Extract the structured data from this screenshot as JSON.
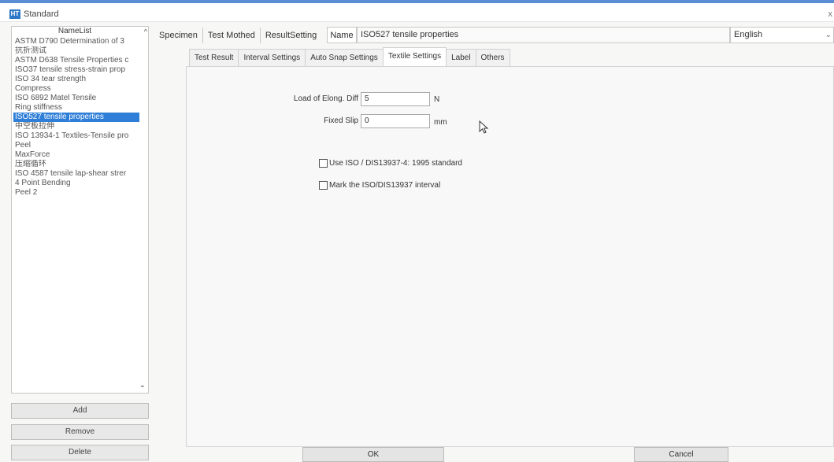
{
  "window": {
    "title": "Standard",
    "app_icon_text": "HT",
    "close_glyph": "x"
  },
  "namelist": {
    "header": "NameList",
    "items": [
      "ASTM D790 Determination of 3",
      "抗折测试",
      "ASTM D638 Tensile Properties c",
      "ISO37 tensile stress-strain prop",
      "ISO 34 tear strength",
      "Compress",
      "ISO 6892 Matel Tensile",
      "Ring stiffness",
      "ISO527 tensile properties",
      "中空板拉伸",
      "ISO 13934-1 Textiles-Tensile pro",
      "Peel",
      "MaxForce",
      "压缩循环",
      "ISO 4587 tensile lap-shear strer",
      "4 Point Bending",
      "Peel 2"
    ],
    "selected_index": 8,
    "buttons": {
      "add": "Add",
      "remove": "Remove",
      "delete": "Delete"
    }
  },
  "top_tabs": [
    "Specimen",
    "Test Mothed",
    "ResultSetting"
  ],
  "name_field": {
    "label": "Name",
    "value": "ISO527 tensile properties"
  },
  "language": {
    "selected": "English"
  },
  "inner_tabs": [
    "Test Result",
    "Interval Settings",
    "Auto Snap Settings",
    "Textile Settings",
    "Label",
    "Others"
  ],
  "active_inner_tab": "Textile Settings",
  "textile": {
    "load_label": "Load of Elong. Diff",
    "load_value": "5",
    "load_unit": "N",
    "slip_label": "Fixed Slip",
    "slip_value": "0",
    "slip_unit": "mm",
    "check1": "Use ISO / DIS13937-4: 1995 standard",
    "check2": "Mark the ISO/DIS13937 interval"
  },
  "footer": {
    "ok": "OK",
    "cancel": "Cancel"
  }
}
